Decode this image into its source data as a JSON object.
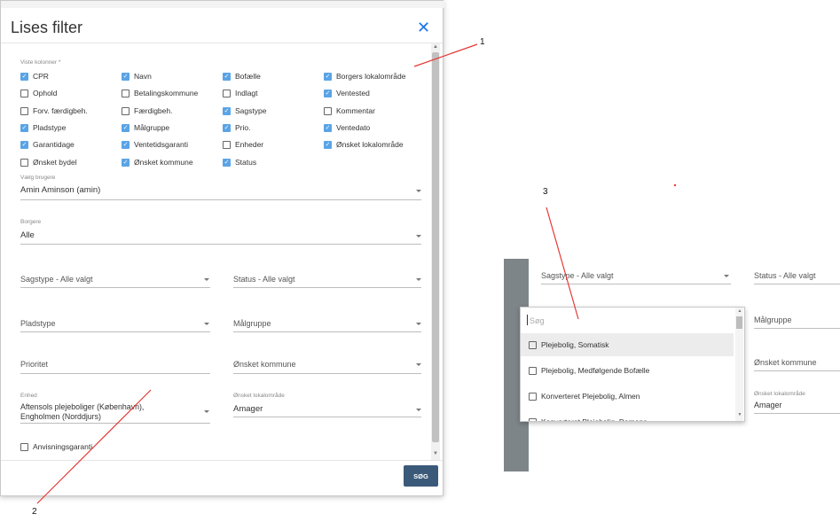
{
  "dialog": {
    "title": "Lises filter",
    "close_icon": "close-icon",
    "columns_label": "Viste kolonner *",
    "columns": [
      {
        "label": "CPR",
        "checked": true
      },
      {
        "label": "Navn",
        "checked": true
      },
      {
        "label": "Bofælle",
        "checked": true
      },
      {
        "label": "Borgers lokalområde",
        "checked": true
      },
      {
        "label": "Ophold",
        "checked": false
      },
      {
        "label": "Betalingskommune",
        "checked": false
      },
      {
        "label": "Indlagt",
        "checked": false
      },
      {
        "label": "Ventested",
        "checked": true
      },
      {
        "label": "Forv. færdigbeh.",
        "checked": false
      },
      {
        "label": "Færdigbeh.",
        "checked": false
      },
      {
        "label": "Sagstype",
        "checked": true
      },
      {
        "label": "Kommentar",
        "checked": false
      },
      {
        "label": "Pladstype",
        "checked": true
      },
      {
        "label": "Målgruppe",
        "checked": true
      },
      {
        "label": "Prio.",
        "checked": true
      },
      {
        "label": "Ventedato",
        "checked": true
      },
      {
        "label": "Garantidage",
        "checked": true
      },
      {
        "label": "Ventetidsgaranti",
        "checked": true
      },
      {
        "label": "Enheder",
        "checked": false
      },
      {
        "label": "Ønsket lokalområde",
        "checked": true
      },
      {
        "label": "Ønsket bydel",
        "checked": false
      },
      {
        "label": "Ønsket kommune",
        "checked": true
      },
      {
        "label": "Status",
        "checked": true
      }
    ],
    "user_label": "Vælg brugere",
    "user_value": "Amin Aminson (amin)",
    "citizens_label": "Borgere",
    "citizens_value": "Alle",
    "sagstype_placeholder": "Sagstype - Alle valgt",
    "status_placeholder": "Status - Alle valgt",
    "pladstype_placeholder": "Pladstype",
    "malgruppe_placeholder": "Målgruppe",
    "prioritet_placeholder": "Prioritet",
    "onsket_kommune_placeholder": "Ønsket kommune",
    "enhed_label": "Enhed",
    "enhed_value_line1": "Aftensols plejeboliger (København),",
    "enhed_value_line2": "Engholmen (Norddjurs)",
    "onsket_lokalomrade_label": "Ønsket lokalområde",
    "onsket_lokalomrade_value": "Amager",
    "anvisning_label": "Anvisningsgaranti",
    "anvisning_checked": false,
    "search_button": "SØG"
  },
  "excerpt": {
    "sagstype_placeholder": "Sagstype - Alle valgt",
    "status_placeholder": "Status - Alle valgt",
    "malgruppe_placeholder": "Målgruppe",
    "onsket_kommune_placeholder": "Ønsket kommune",
    "onsket_lokalomrade_label": "Ønsket lokalområde",
    "onsket_lokalomrade_value": "Amager",
    "dropdown": {
      "search_placeholder": "Søg",
      "options": [
        {
          "label": "Plejebolig, Somatisk",
          "checked": false
        },
        {
          "label": "Plejebolig, Medfølgende Bofælle",
          "checked": false
        },
        {
          "label": "Konverteret Plejebolig, Almen",
          "checked": false
        },
        {
          "label": "Konverteret Plejebolig, Demens",
          "checked": false
        }
      ]
    }
  },
  "annotations": {
    "one": "1",
    "two": "2",
    "three": "3",
    "line_color": "#e53935"
  }
}
